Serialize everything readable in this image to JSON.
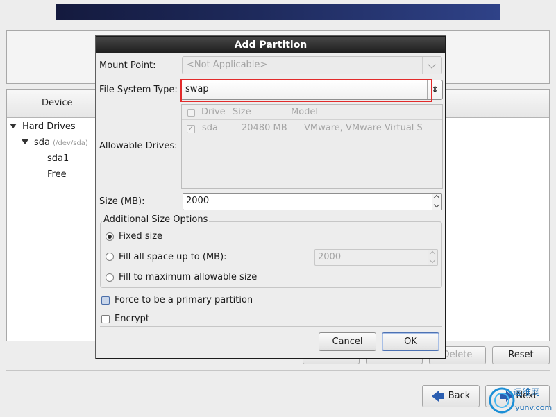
{
  "background": {
    "tree": {
      "column_header": "Device",
      "items": [
        {
          "label": "Hard Drives"
        },
        {
          "label": "sda",
          "sublabel": "(/dev/sda)"
        },
        {
          "label": "sda1"
        },
        {
          "label": "Free"
        }
      ]
    },
    "buttons": {
      "delete": "Delete",
      "reset": "Reset",
      "back": "Back",
      "next": "Next"
    },
    "watermark": {
      "text_cn": "运维网",
      "text": "iyunv.com"
    }
  },
  "dialog": {
    "title": "Add Partition",
    "mount_point": {
      "label": "Mount Point:",
      "value": "<Not Applicable>"
    },
    "file_system_type": {
      "label": "File System Type:",
      "value": "swap"
    },
    "allowable_drives": {
      "label": "Allowable Drives:",
      "columns": [
        "Drive",
        "Size",
        "Model"
      ],
      "rows": [
        {
          "checked": true,
          "drive": "sda",
          "size": "20480 MB",
          "model": "VMware, VMware Virtual S"
        }
      ]
    },
    "size": {
      "label": "Size (MB):",
      "value": "2000"
    },
    "size_options": {
      "title": "Additional Size Options",
      "fixed": "Fixed size",
      "fill_up_to": "Fill all space up to (MB):",
      "fill_up_to_value": "2000",
      "fill_max": "Fill to maximum allowable size",
      "selected": "fixed"
    },
    "force_primary": {
      "label": "Force to be a primary partition",
      "checked": false
    },
    "encrypt": {
      "label": "Encrypt",
      "checked": false
    },
    "buttons": {
      "cancel": "Cancel",
      "ok": "OK"
    }
  },
  "colors": {
    "highlight": "#e22b2b",
    "title_bar": "#2a2a2a",
    "accent": "#2a5db0"
  }
}
